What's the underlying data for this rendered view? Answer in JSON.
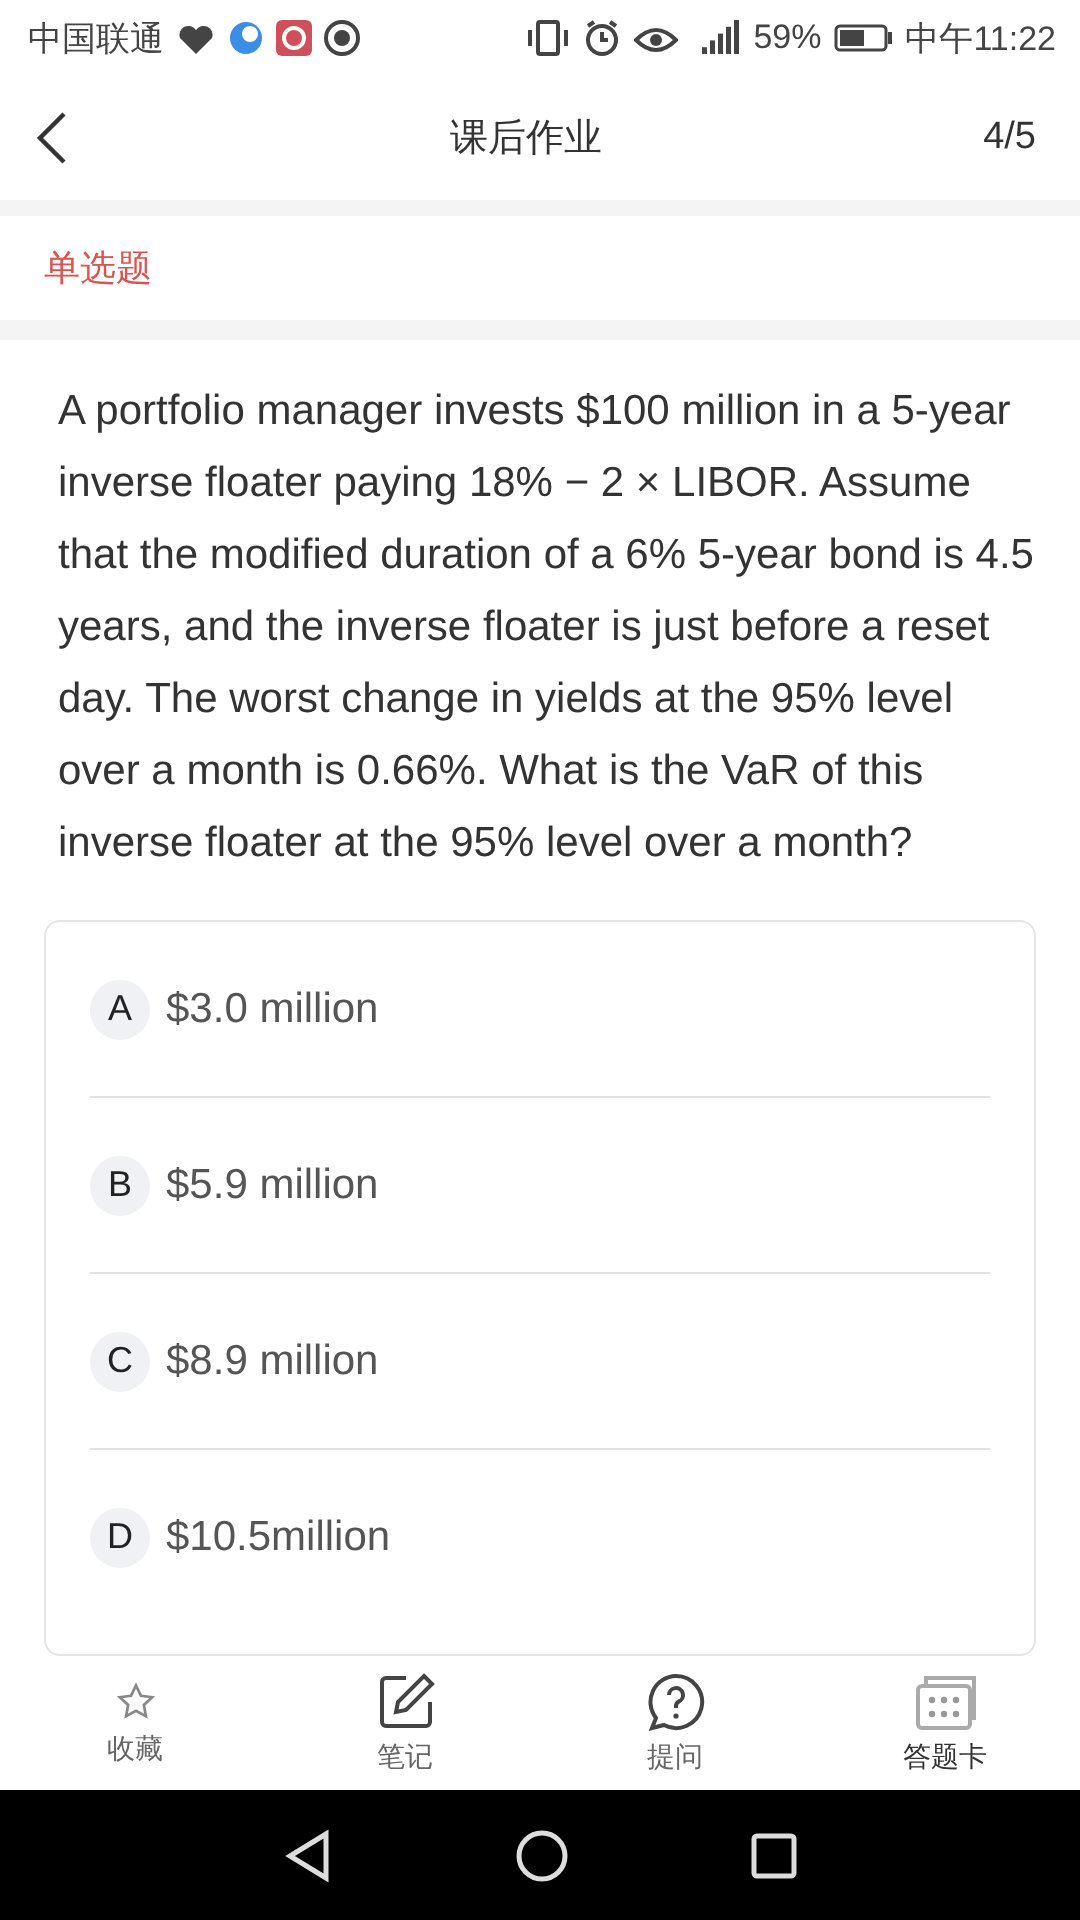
{
  "status_bar": {
    "carrier": "中国联通",
    "battery": "59%",
    "time": "中午11:22"
  },
  "header": {
    "title": "课后作业",
    "progress": "4/5"
  },
  "question_type": "单选题",
  "question": {
    "text": "A portfolio manager invests $100 million in a 5-year inverse floater paying 18% − 2 × LIBOR. Assume that the modified duration of a 6% 5-year bond is 4.5 years, and the inverse floater is just before a reset day. The worst change in yields at the 95% level over a month is 0.66%. What is the VaR of this inverse floater at the 95% level over a month?",
    "options": [
      {
        "letter": "A",
        "text": "$3.0 million"
      },
      {
        "letter": "B",
        "text": "$5.9 million"
      },
      {
        "letter": "C",
        "text": "$8.9 million"
      },
      {
        "letter": "D",
        "text": "$10.5million"
      }
    ]
  },
  "toolbar": [
    {
      "kind": "star",
      "label": "收藏"
    },
    {
      "kind": "note",
      "label": "笔记"
    },
    {
      "kind": "ask",
      "label": "提问"
    },
    {
      "kind": "card",
      "label": "答题卡"
    }
  ]
}
